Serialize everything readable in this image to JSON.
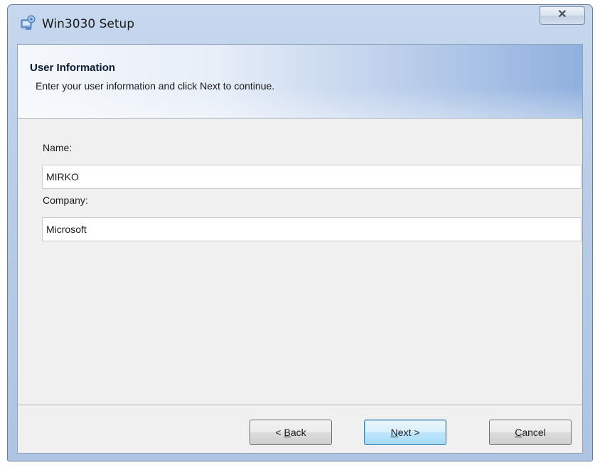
{
  "window": {
    "title": "Win3030 Setup",
    "close_glyph": "✕",
    "icon": "setup-icon"
  },
  "banner": {
    "title": "User Information",
    "subtitle": "Enter your user information and click Next to continue."
  },
  "form": {
    "name_label": "Name:",
    "name_value": "MIRKO",
    "company_label": "Company:",
    "company_value": "Microsoft"
  },
  "buttons": {
    "back": {
      "prefix": "< ",
      "mnemonic": "B",
      "rest": "ack"
    },
    "next": {
      "mnemonic": "N",
      "rest": "ext >"
    },
    "cancel": {
      "mnemonic": "C",
      "rest": "ancel"
    }
  },
  "colors": {
    "titlebar": "#b9cde7",
    "client_bg": "#f0f0f0",
    "default_button_border": "#3c7fb1"
  }
}
